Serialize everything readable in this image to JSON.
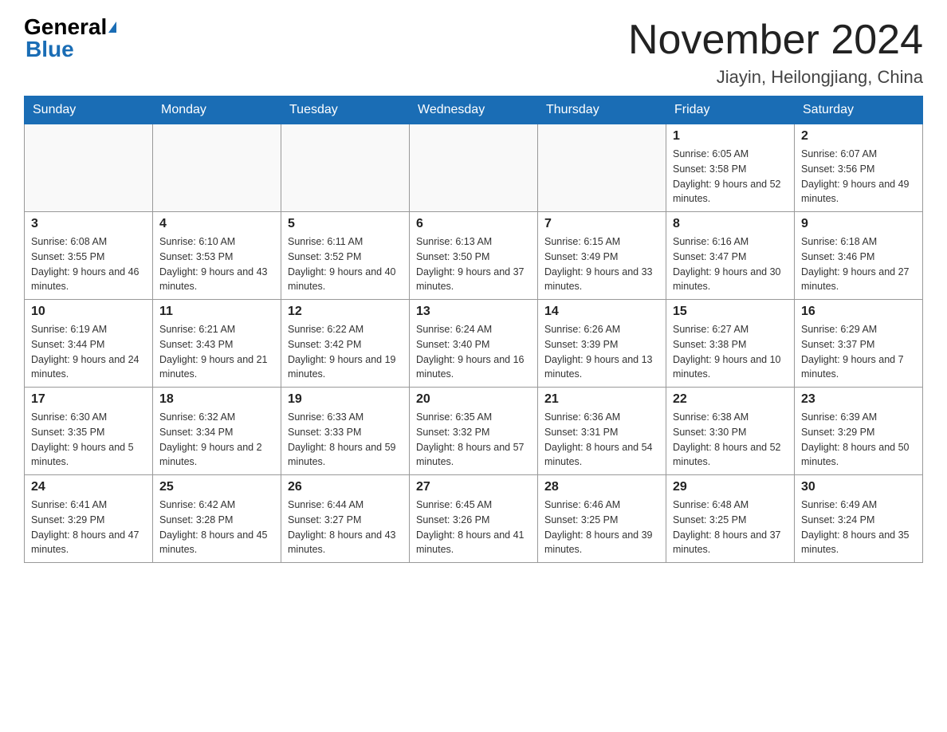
{
  "header": {
    "logo_general": "General",
    "logo_blue": "Blue",
    "month_title": "November 2024",
    "location": "Jiayin, Heilongjiang, China"
  },
  "days_of_week": [
    "Sunday",
    "Monday",
    "Tuesday",
    "Wednesday",
    "Thursday",
    "Friday",
    "Saturday"
  ],
  "weeks": [
    [
      {
        "day": "",
        "info": ""
      },
      {
        "day": "",
        "info": ""
      },
      {
        "day": "",
        "info": ""
      },
      {
        "day": "",
        "info": ""
      },
      {
        "day": "",
        "info": ""
      },
      {
        "day": "1",
        "info": "Sunrise: 6:05 AM\nSunset: 3:58 PM\nDaylight: 9 hours and 52 minutes."
      },
      {
        "day": "2",
        "info": "Sunrise: 6:07 AM\nSunset: 3:56 PM\nDaylight: 9 hours and 49 minutes."
      }
    ],
    [
      {
        "day": "3",
        "info": "Sunrise: 6:08 AM\nSunset: 3:55 PM\nDaylight: 9 hours and 46 minutes."
      },
      {
        "day": "4",
        "info": "Sunrise: 6:10 AM\nSunset: 3:53 PM\nDaylight: 9 hours and 43 minutes."
      },
      {
        "day": "5",
        "info": "Sunrise: 6:11 AM\nSunset: 3:52 PM\nDaylight: 9 hours and 40 minutes."
      },
      {
        "day": "6",
        "info": "Sunrise: 6:13 AM\nSunset: 3:50 PM\nDaylight: 9 hours and 37 minutes."
      },
      {
        "day": "7",
        "info": "Sunrise: 6:15 AM\nSunset: 3:49 PM\nDaylight: 9 hours and 33 minutes."
      },
      {
        "day": "8",
        "info": "Sunrise: 6:16 AM\nSunset: 3:47 PM\nDaylight: 9 hours and 30 minutes."
      },
      {
        "day": "9",
        "info": "Sunrise: 6:18 AM\nSunset: 3:46 PM\nDaylight: 9 hours and 27 minutes."
      }
    ],
    [
      {
        "day": "10",
        "info": "Sunrise: 6:19 AM\nSunset: 3:44 PM\nDaylight: 9 hours and 24 minutes."
      },
      {
        "day": "11",
        "info": "Sunrise: 6:21 AM\nSunset: 3:43 PM\nDaylight: 9 hours and 21 minutes."
      },
      {
        "day": "12",
        "info": "Sunrise: 6:22 AM\nSunset: 3:42 PM\nDaylight: 9 hours and 19 minutes."
      },
      {
        "day": "13",
        "info": "Sunrise: 6:24 AM\nSunset: 3:40 PM\nDaylight: 9 hours and 16 minutes."
      },
      {
        "day": "14",
        "info": "Sunrise: 6:26 AM\nSunset: 3:39 PM\nDaylight: 9 hours and 13 minutes."
      },
      {
        "day": "15",
        "info": "Sunrise: 6:27 AM\nSunset: 3:38 PM\nDaylight: 9 hours and 10 minutes."
      },
      {
        "day": "16",
        "info": "Sunrise: 6:29 AM\nSunset: 3:37 PM\nDaylight: 9 hours and 7 minutes."
      }
    ],
    [
      {
        "day": "17",
        "info": "Sunrise: 6:30 AM\nSunset: 3:35 PM\nDaylight: 9 hours and 5 minutes."
      },
      {
        "day": "18",
        "info": "Sunrise: 6:32 AM\nSunset: 3:34 PM\nDaylight: 9 hours and 2 minutes."
      },
      {
        "day": "19",
        "info": "Sunrise: 6:33 AM\nSunset: 3:33 PM\nDaylight: 8 hours and 59 minutes."
      },
      {
        "day": "20",
        "info": "Sunrise: 6:35 AM\nSunset: 3:32 PM\nDaylight: 8 hours and 57 minutes."
      },
      {
        "day": "21",
        "info": "Sunrise: 6:36 AM\nSunset: 3:31 PM\nDaylight: 8 hours and 54 minutes."
      },
      {
        "day": "22",
        "info": "Sunrise: 6:38 AM\nSunset: 3:30 PM\nDaylight: 8 hours and 52 minutes."
      },
      {
        "day": "23",
        "info": "Sunrise: 6:39 AM\nSunset: 3:29 PM\nDaylight: 8 hours and 50 minutes."
      }
    ],
    [
      {
        "day": "24",
        "info": "Sunrise: 6:41 AM\nSunset: 3:29 PM\nDaylight: 8 hours and 47 minutes."
      },
      {
        "day": "25",
        "info": "Sunrise: 6:42 AM\nSunset: 3:28 PM\nDaylight: 8 hours and 45 minutes."
      },
      {
        "day": "26",
        "info": "Sunrise: 6:44 AM\nSunset: 3:27 PM\nDaylight: 8 hours and 43 minutes."
      },
      {
        "day": "27",
        "info": "Sunrise: 6:45 AM\nSunset: 3:26 PM\nDaylight: 8 hours and 41 minutes."
      },
      {
        "day": "28",
        "info": "Sunrise: 6:46 AM\nSunset: 3:25 PM\nDaylight: 8 hours and 39 minutes."
      },
      {
        "day": "29",
        "info": "Sunrise: 6:48 AM\nSunset: 3:25 PM\nDaylight: 8 hours and 37 minutes."
      },
      {
        "day": "30",
        "info": "Sunrise: 6:49 AM\nSunset: 3:24 PM\nDaylight: 8 hours and 35 minutes."
      }
    ]
  ]
}
